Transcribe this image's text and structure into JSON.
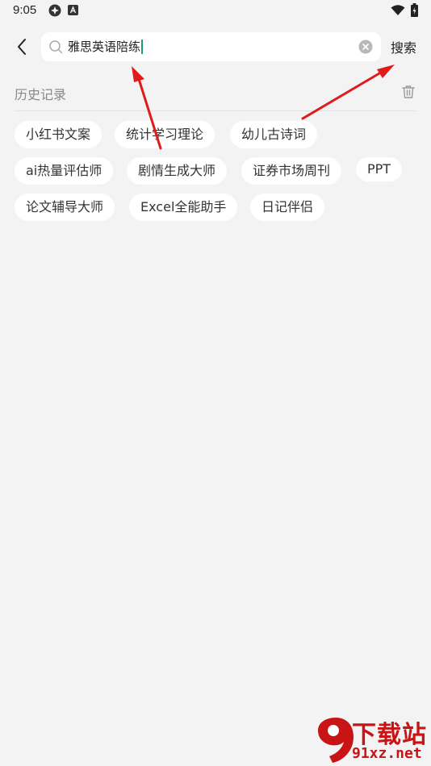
{
  "status_bar": {
    "time": "9:05"
  },
  "header": {
    "search_value": "雅思英语陪练",
    "search_button": "搜索"
  },
  "history": {
    "title": "历史记录",
    "chips": [
      "小红书文案",
      "统计学习理论",
      "幼儿古诗词",
      "ai热量评估师",
      "剧情生成大师",
      "证券市场周刊",
      "PPT",
      "论文辅导大师",
      "Excel全能助手",
      "日记伴侣"
    ]
  },
  "watermark": {
    "title": "下载站",
    "url": "91xz.net",
    "logo_text": "91"
  },
  "colors": {
    "background": "#f3f3f3",
    "chip_bg": "#ffffff",
    "arrow": "#e01b1b",
    "caret": "#1a9f6a",
    "watermark": "#c81414"
  },
  "icons": {
    "back": "back-arrow-icon",
    "search": "search-icon",
    "clear": "clear-icon",
    "trash": "trash-icon"
  }
}
